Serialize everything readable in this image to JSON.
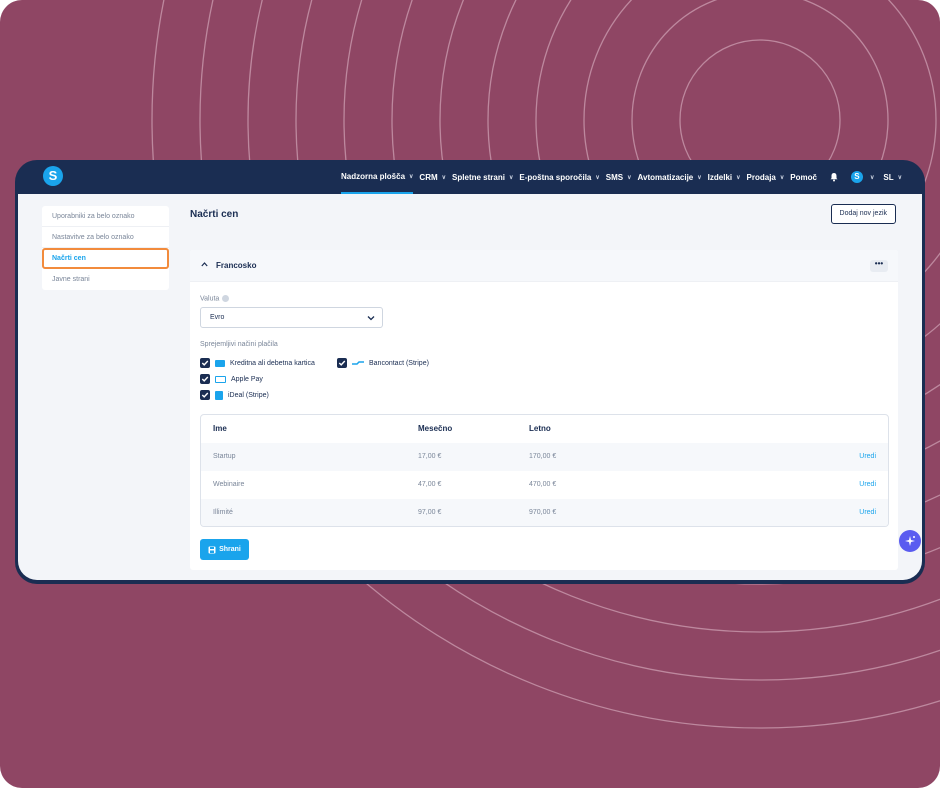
{
  "app": {
    "logo_letter": "S",
    "avatar_letter": "S"
  },
  "nav": [
    {
      "label": "Nadzorna plošča",
      "active": true
    },
    {
      "label": "CRM"
    },
    {
      "label": "Spletne strani"
    },
    {
      "label": "E-poštna sporočila"
    },
    {
      "label": "SMS"
    },
    {
      "label": "Avtomatizacije"
    },
    {
      "label": "Izdelki"
    },
    {
      "label": "Prodaja"
    },
    {
      "label": "Pomoč"
    }
  ],
  "nav_lang": "SL",
  "sidebar": {
    "items": [
      {
        "label": "Uporabniki za belo oznako"
      },
      {
        "label": "Nastavitve za belo oznako"
      },
      {
        "label": "Načrti cen"
      },
      {
        "label": "Javne strani"
      }
    ]
  },
  "page": {
    "title": "Načrti cen",
    "add_language_button": "Dodaj nov jezik"
  },
  "panel": {
    "language": "Francosko",
    "more": "•••",
    "currency_label": "Valuta",
    "currency_value": "Evro",
    "payment_methods_label": "Sprejemljivi načini plačila",
    "payment_methods": [
      {
        "label": "Kreditna ali debetna kartica",
        "checked": true
      },
      {
        "label": "Bancontact (Stripe)",
        "checked": true
      },
      {
        "label": "Apple Pay",
        "checked": true
      },
      {
        "label": "iDeal (Stripe)",
        "checked": true
      }
    ],
    "table": {
      "headers": [
        "Ime",
        "Mesečno",
        "Letno"
      ],
      "rows": [
        {
          "name": "Startup",
          "monthly": "17,00 €",
          "yearly": "170,00 €",
          "action": "Uredi"
        },
        {
          "name": "Webinaire",
          "monthly": "47,00 €",
          "yearly": "470,00 €",
          "action": "Uredi"
        },
        {
          "name": "Illimité",
          "monthly": "97,00 €",
          "yearly": "970,00 €",
          "action": "Uredi"
        }
      ]
    },
    "save_button": "Shrani"
  },
  "colors": {
    "background": "#8f4664",
    "window": "#1a2d52",
    "accent": "#1aa4ec",
    "highlight": "#f28b3c",
    "fab": "#5a5cf0"
  }
}
